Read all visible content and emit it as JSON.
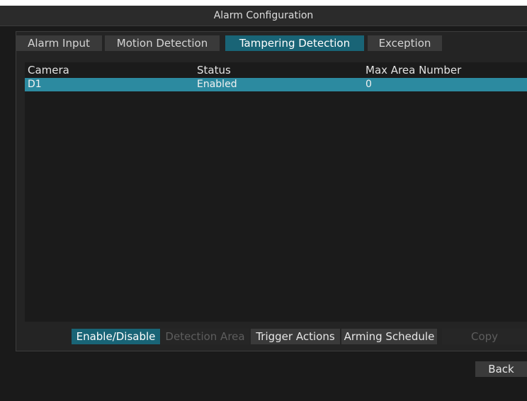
{
  "window": {
    "title": "Alarm Configuration"
  },
  "tabs": [
    {
      "label": "Alarm Input",
      "active": false
    },
    {
      "label": "Motion Detection",
      "active": false
    },
    {
      "label": "Tampering Detection",
      "active": true
    },
    {
      "label": "Exception",
      "active": false
    }
  ],
  "table": {
    "columns": [
      "Camera",
      "Status",
      "Max Area Number"
    ],
    "rows": [
      {
        "camera": "D1",
        "status": "Enabled",
        "max_area_number": "0",
        "selected": true
      }
    ]
  },
  "actions": [
    {
      "label": "Enable/Disable",
      "state": "primary"
    },
    {
      "label": "Detection Area",
      "state": "disabled"
    },
    {
      "label": "Trigger Actions",
      "state": "normal"
    },
    {
      "label": "Arming Schedule",
      "state": "normal"
    },
    {
      "label": "Copy",
      "state": "disabled"
    }
  ],
  "back_button": "Back",
  "colors": {
    "accent": "#196476",
    "selection": "#2c8aa0",
    "background": "#1a1a1a"
  }
}
